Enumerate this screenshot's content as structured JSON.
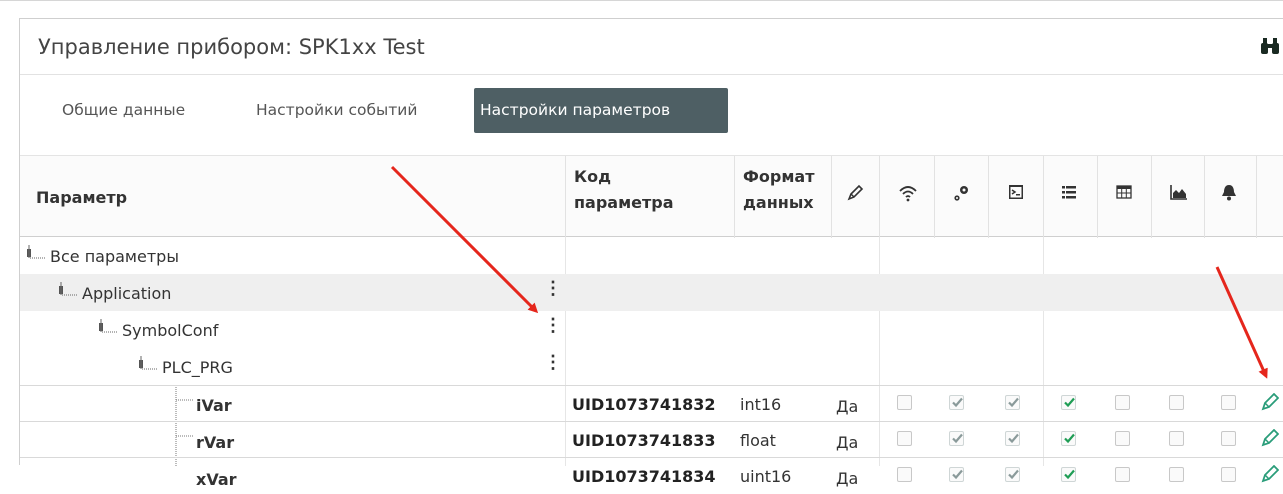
{
  "title": "Управление прибором: SPK1xx Test",
  "tabs": [
    "Общие данные",
    "Настройки событий",
    "Настройки параметров"
  ],
  "active_tab": "Настройки параметров",
  "columns": {
    "param": "Параметр",
    "code_l1": "Код",
    "code_l2": "параметра",
    "fmt_l1": "Формат",
    "fmt_l2": "данных"
  },
  "tree": {
    "root": "Все параметры",
    "app": "Application",
    "sym": "SymbolConf",
    "plc": "PLC_PRG"
  },
  "rows": [
    {
      "name": "iVar",
      "code": "UID1073741832",
      "format": "int16",
      "flag": "Да"
    },
    {
      "name": "rVar",
      "code": "UID1073741833",
      "format": "float",
      "flag": "Да"
    },
    {
      "name": "xVar",
      "code": "UID1073741834",
      "format": "uint16",
      "flag": "Да"
    }
  ],
  "icons": [
    "edit-icon",
    "wifi-icon",
    "gears-icon",
    "terminal-icon",
    "list-icon",
    "table-icon",
    "area-chart-icon",
    "bell-icon",
    "binoculars-icon"
  ],
  "colors": {
    "accent_tab": "#4e5f64",
    "check_green": "#1f9d55",
    "check_gray": "#8a9a9a",
    "arrow_red": "#e5261c",
    "edit_green": "#2a9d7a"
  }
}
